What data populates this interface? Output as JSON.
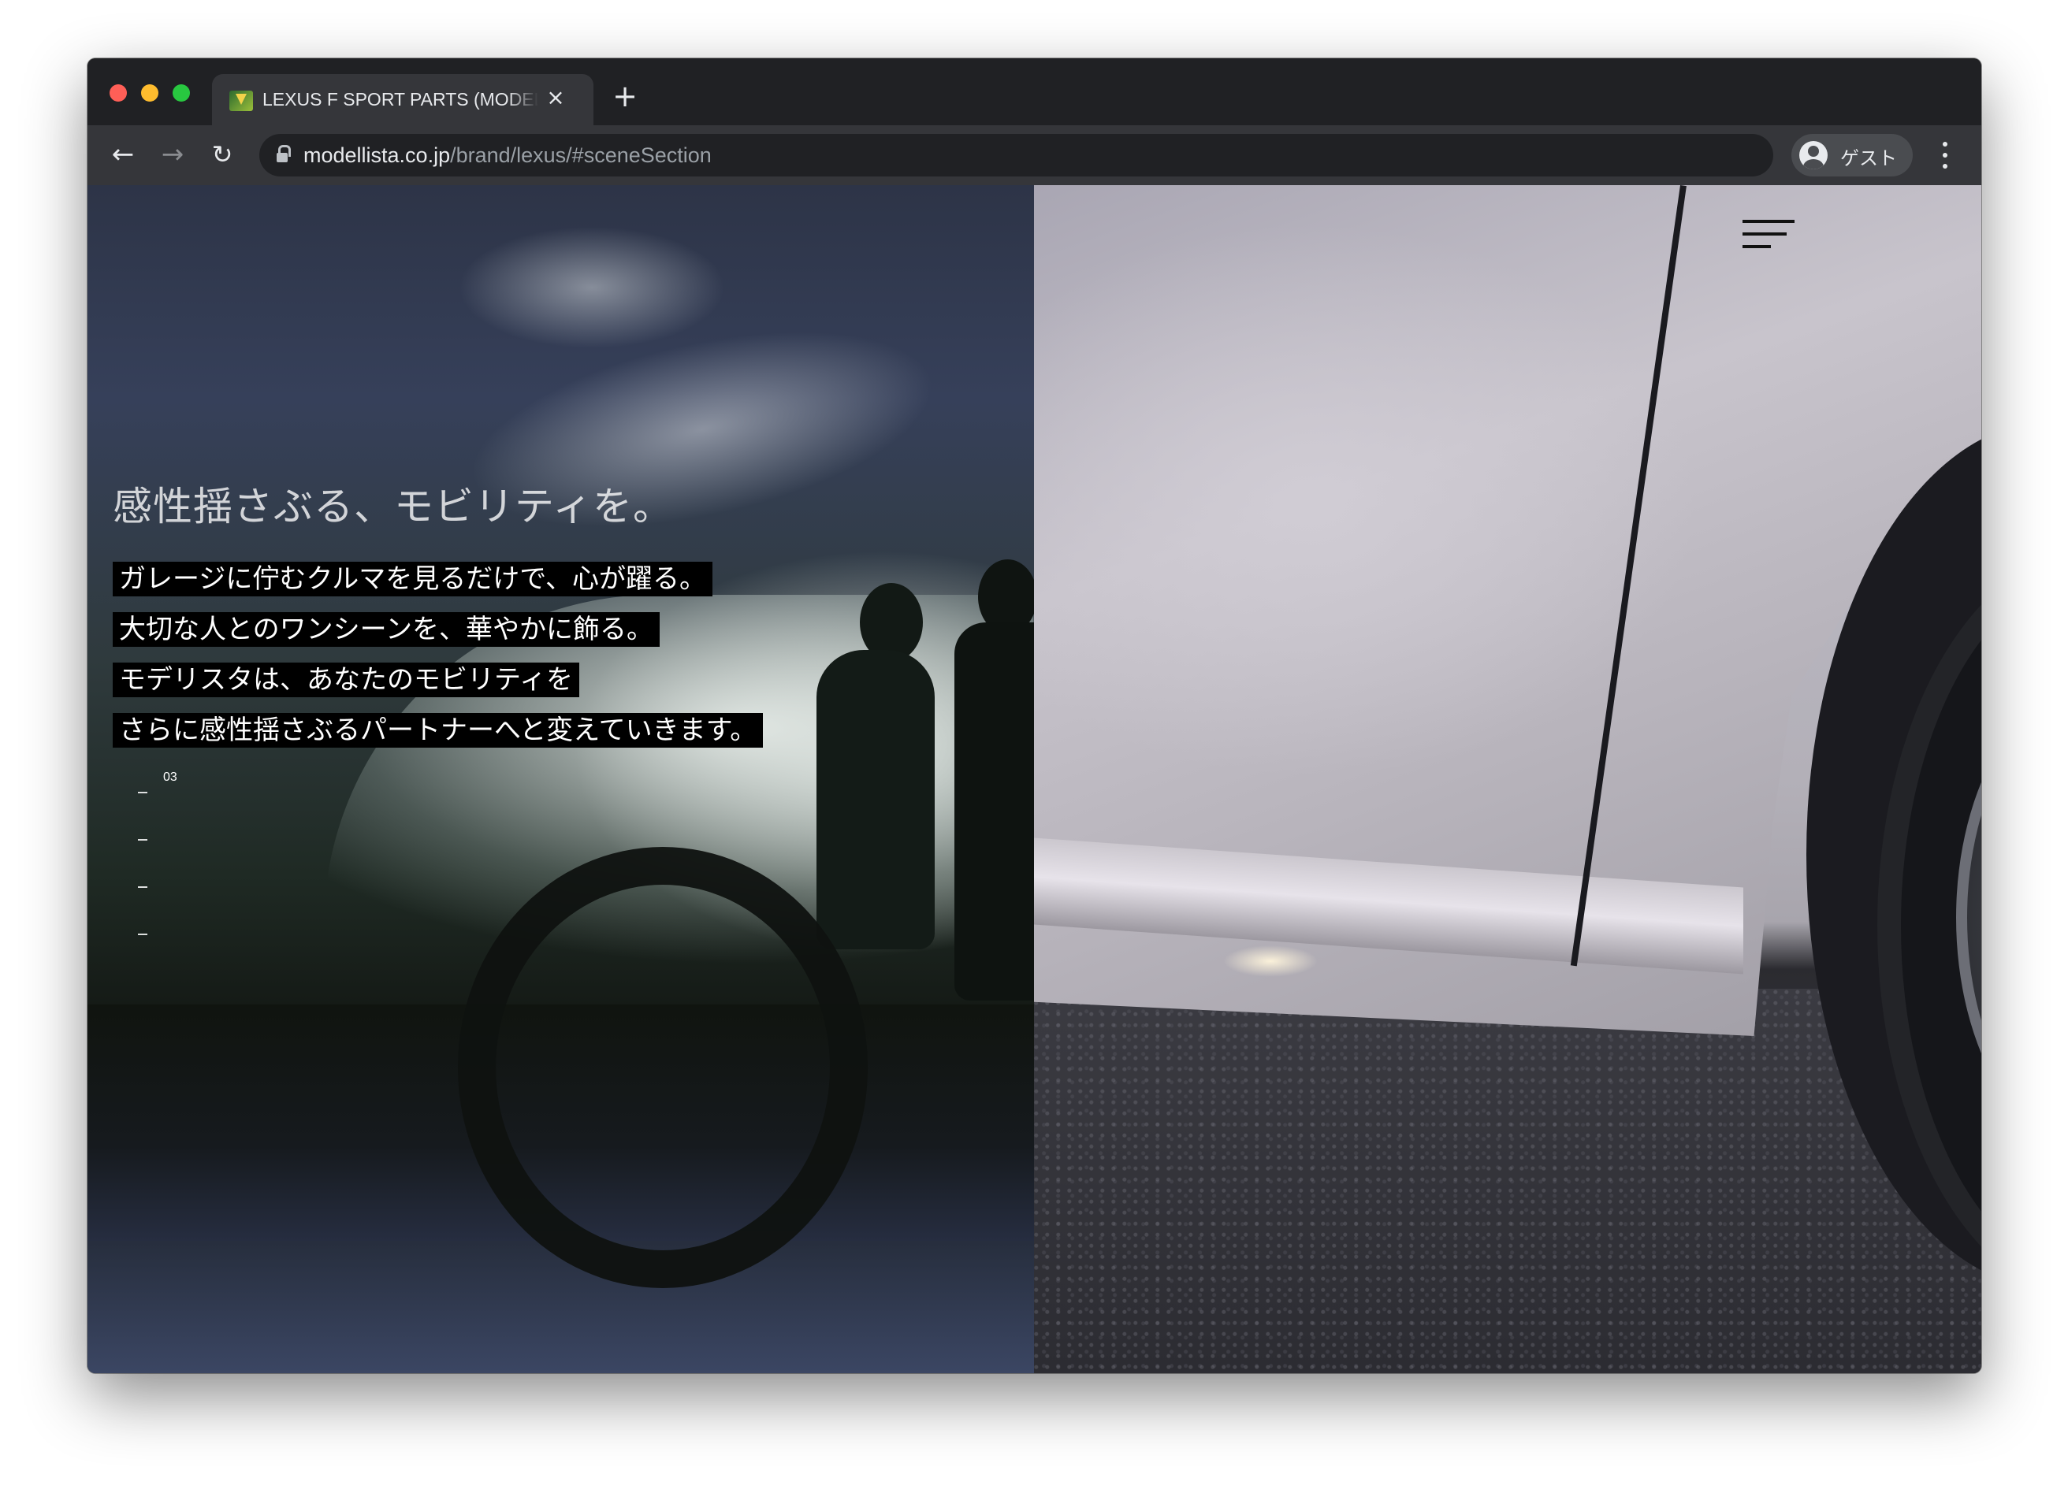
{
  "browser": {
    "tab_title": "LEXUS F SPORT PARTS (MODELLISTA)",
    "tab_close": "×",
    "new_tab": "+",
    "url_host": "modellista.co.jp",
    "url_path": "/brand/lexus/#sceneSection",
    "profile_label": "ゲスト",
    "nav": {
      "back": "←",
      "forward": "→",
      "reload": "↻"
    }
  },
  "hero": {
    "headline": "感性揺さぶる、モビリティを。",
    "body_lines": [
      "ガレージに佇むクルマを見るだけで、心が躍る。",
      "大切な人とのワンシーンを、華やかに飾る。",
      "モデリスタは、あなたのモビリティを",
      "さらに感性揺さぶるパートナーへと変えていきます。"
    ],
    "scene_indicator": "03"
  },
  "icons": {
    "favicon": "modellista-logo-icon",
    "lock": "lock-icon",
    "profile": "avatar-icon",
    "menu": "hamburger-menu-icon",
    "more": "more-vert-icon"
  }
}
